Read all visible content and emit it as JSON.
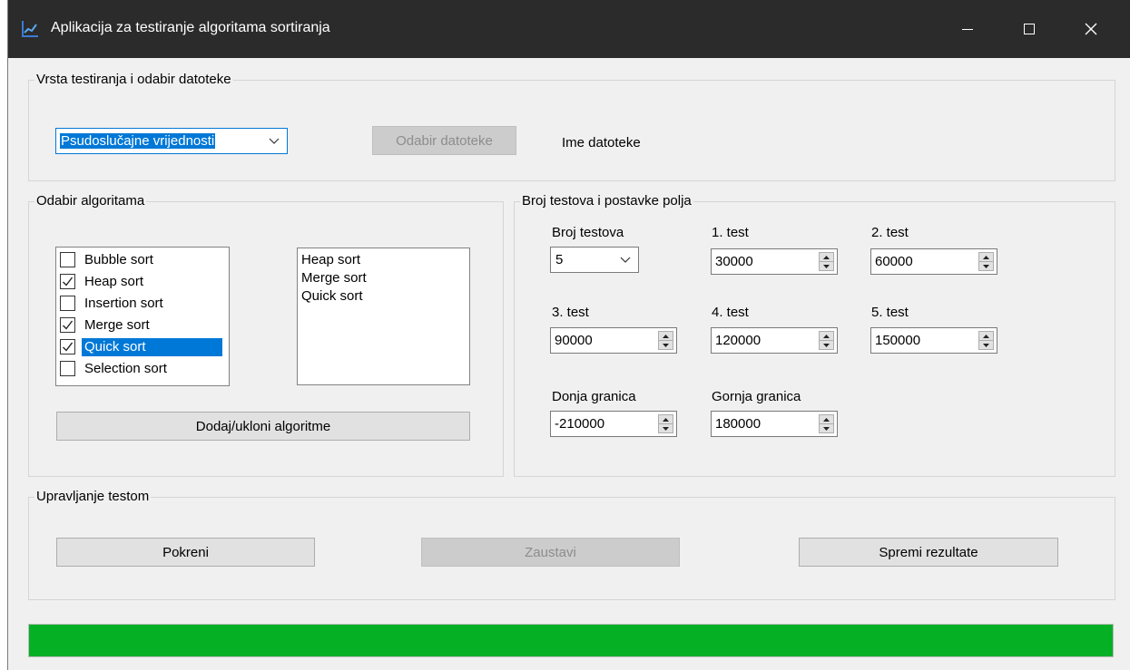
{
  "window": {
    "title": "Aplikacija za testiranje algoritama sortiranja",
    "controls": [
      "minimize-icon",
      "maximize-icon",
      "close-icon"
    ]
  },
  "test_type_group": {
    "legend": "Vrsta testiranja i odabir datoteke",
    "mode_value": "Psudoslučajne vrijednosti",
    "choose_file_label": "Odabir datoteke",
    "file_name_label": "Ime datoteke"
  },
  "algorithm_group": {
    "legend": "Odabir algoritama",
    "checklist": [
      {
        "label": "Bubble sort",
        "checked": false,
        "selected": false
      },
      {
        "label": "Heap sort",
        "checked": true,
        "selected": false
      },
      {
        "label": "Insertion sort",
        "checked": false,
        "selected": false
      },
      {
        "label": "Merge sort",
        "checked": true,
        "selected": false
      },
      {
        "label": "Quick sort",
        "checked": true,
        "selected": true
      },
      {
        "label": "Selection sort",
        "checked": false,
        "selected": false
      }
    ],
    "chosen_list": [
      "Heap sort",
      "Merge sort",
      "Quick sort"
    ],
    "add_remove_label": "Dodaj/ukloni algoritme"
  },
  "settings_group": {
    "legend": "Broj testova i postavke polja",
    "test_count_label": "Broj testova",
    "test_count_value": "5",
    "test1_label": "1. test",
    "test1_value": "30000",
    "test2_label": "2. test",
    "test2_value": "60000",
    "test3_label": "3. test",
    "test3_value": "90000",
    "test4_label": "4. test",
    "test4_value": "120000",
    "test5_label": "5. test",
    "test5_value": "150000",
    "lower_label": "Donja granica",
    "lower_value": "-210000",
    "upper_label": "Gornja granica",
    "upper_value": "180000"
  },
  "control_group": {
    "legend": "Upravljanje testom",
    "start_label": "Pokreni",
    "stop_label": "Zaustavi",
    "save_label": "Spremi rezultate"
  },
  "progress": {
    "fraction": 1.0,
    "color": "#06b025"
  },
  "colors": {
    "titlebar": "#2b2b2b",
    "accent": "#0078d7",
    "window_bg": "#f0f0f0"
  }
}
